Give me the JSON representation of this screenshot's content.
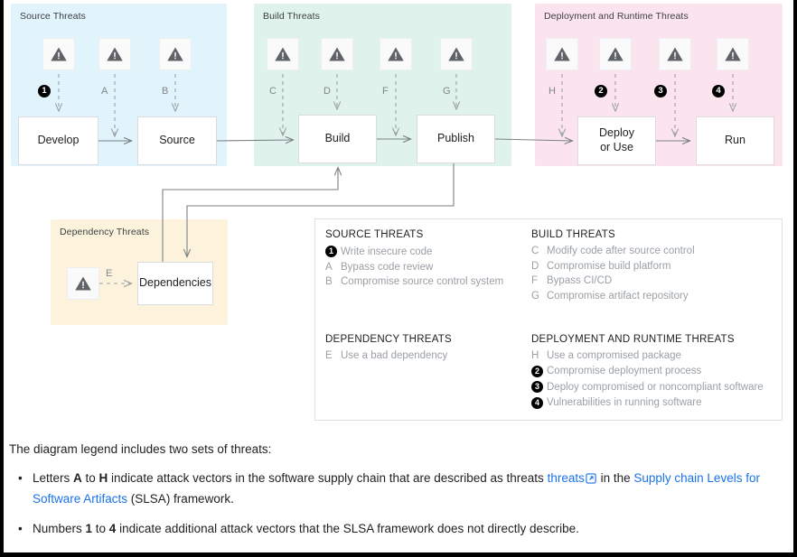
{
  "zones": {
    "source": {
      "label": "Source Threats"
    },
    "build": {
      "label": "Build Threats"
    },
    "deployment": {
      "label": "Deployment and Runtime Threats"
    },
    "dependency": {
      "label": "Dependency Threats"
    }
  },
  "nodes": {
    "develop": "Develop",
    "source": "Source",
    "build": "Build",
    "publish": "Publish",
    "deploy": "Deploy\nor Use",
    "deploy_line1": "Deploy",
    "deploy_line2": "or Use",
    "run": "Run",
    "dependencies": "Dependencies"
  },
  "markers": {
    "m1": "1",
    "m2": "2",
    "m3": "3",
    "m4": "4",
    "A": "A",
    "B": "B",
    "C": "C",
    "D": "D",
    "E": "E",
    "F": "F",
    "G": "G",
    "H": "H"
  },
  "legend": {
    "source": {
      "title": "SOURCE THREATS",
      "items": [
        {
          "key": "1",
          "key_type": "number",
          "text": "Write insecure code"
        },
        {
          "key": "A",
          "key_type": "letter",
          "text": "Bypass code review"
        },
        {
          "key": "B",
          "key_type": "letter",
          "text": "Compromise source control system"
        }
      ]
    },
    "build": {
      "title": "BUILD THREATS",
      "items": [
        {
          "key": "C",
          "key_type": "letter",
          "text": "Modify code after source control"
        },
        {
          "key": "D",
          "key_type": "letter",
          "text": "Compromise build platform"
        },
        {
          "key": "F",
          "key_type": "letter",
          "text": "Bypass CI/CD"
        },
        {
          "key": "G",
          "key_type": "letter",
          "text": "Compromise artifact repository"
        }
      ]
    },
    "dependency": {
      "title": "DEPENDENCY THREATS",
      "items": [
        {
          "key": "E",
          "key_type": "letter",
          "text": "Use a bad dependency"
        }
      ]
    },
    "deployment": {
      "title": "DEPLOYMENT AND RUNTIME THREATS",
      "items": [
        {
          "key": "H",
          "key_type": "letter",
          "text": "Use a compromised package"
        },
        {
          "key": "2",
          "key_type": "number",
          "text": "Compromise deployment process"
        },
        {
          "key": "3",
          "key_type": "number",
          "text": "Deploy compromised or noncompliant software"
        },
        {
          "key": "4",
          "key_type": "number",
          "text": "Vulnerabilities in running software"
        }
      ]
    }
  },
  "prose": {
    "intro": "The diagram legend includes two sets of threats:",
    "bullet1": {
      "p1": "Letters ",
      "b1": "A",
      "p2": " to ",
      "b2": "H",
      "p3": " indicate attack vectors in the software supply chain that are described as threats ",
      "link1": "threats",
      "p4": " in the ",
      "link2": "Supply chain Levels for Software Artifacts",
      "p5": " (SLSA) framework."
    },
    "bullet2": {
      "p1": "Numbers ",
      "b1": "1",
      "p2": " to ",
      "b2": "4",
      "p3": " indicate additional attack vectors that the SLSA framework does not directly describe."
    }
  },
  "colors": {
    "zone_source": "#e1f3fb",
    "zone_build": "#e0f2ec",
    "zone_deployment": "#fce4ef",
    "zone_dependency": "#fdf3dc",
    "link": "#1a73e8",
    "warning_icon": "#5f6368",
    "connector": "#7a8287",
    "badge": "#000000"
  },
  "icons": {
    "warning": "warning-triangle-icon",
    "external_link": "external-link-icon"
  }
}
